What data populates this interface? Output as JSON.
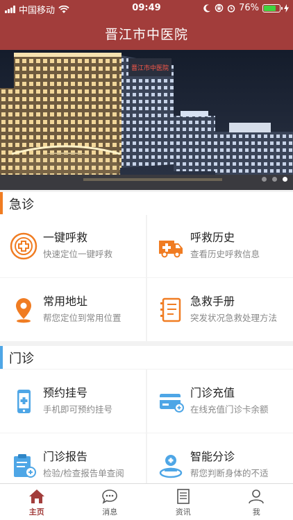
{
  "status": {
    "carrier": "中国移动",
    "time": "09:49",
    "battery": "76%"
  },
  "nav": {
    "title": "晋江市中医院"
  },
  "banner": {
    "sign": "晋江市中医院"
  },
  "sections": {
    "emergency": {
      "title": "急诊",
      "cards": [
        {
          "title": "一键呼救",
          "subtitle": "快速定位一键呼救",
          "icon": "plus-circle-icon"
        },
        {
          "title": "呼救历史",
          "subtitle": "查看历史呼救信息",
          "icon": "ambulance-icon"
        },
        {
          "title": "常用地址",
          "subtitle": "帮您定位到常用位置",
          "icon": "location-pin-icon"
        },
        {
          "title": "急救手册",
          "subtitle": "突发状况急救处理方法",
          "icon": "manual-icon"
        }
      ]
    },
    "outpatient": {
      "title": "门诊",
      "cards": [
        {
          "title": "预约挂号",
          "subtitle": "手机即可预约挂号",
          "icon": "phone-plus-icon"
        },
        {
          "title": "门诊充值",
          "subtitle": "在线充值门诊卡余额",
          "icon": "card-icon"
        },
        {
          "title": "门诊报告",
          "subtitle": "检验/检查报告单查阅",
          "icon": "clipboard-icon"
        },
        {
          "title": "智能分诊",
          "subtitle": "帮您判断身体的不适",
          "icon": "triage-icon"
        }
      ]
    }
  },
  "tabs": [
    {
      "label": "主页",
      "icon": "home-icon",
      "active": true
    },
    {
      "label": "消息",
      "icon": "message-icon",
      "active": false
    },
    {
      "label": "资讯",
      "icon": "news-icon",
      "active": false
    },
    {
      "label": "我",
      "icon": "user-icon",
      "active": false
    }
  ],
  "colors": {
    "brand": "#a23d3b",
    "emergency_accent": "#f07c22",
    "outpatient_accent": "#4ea6e6",
    "battery": "#3fd33f"
  }
}
